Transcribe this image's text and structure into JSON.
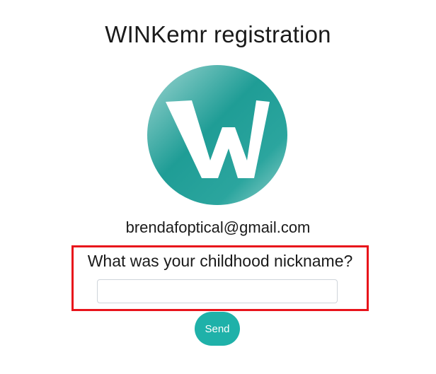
{
  "header": {
    "title": "WINKemr registration"
  },
  "logo": {
    "icon": "winkemr-w-logo-icon",
    "colors": {
      "teal_dark": "#1f9d96",
      "teal_light": "#8fd0cb",
      "letter": "#ffffff"
    }
  },
  "account": {
    "email": "brendafoptical@gmail.com"
  },
  "security_question": {
    "question": "What was your childhood nickname?",
    "answer_value": "",
    "answer_placeholder": ""
  },
  "actions": {
    "send_label": "Send"
  },
  "highlight": {
    "color": "#e8141b"
  },
  "theme": {
    "accent": "#1fb1a9"
  }
}
